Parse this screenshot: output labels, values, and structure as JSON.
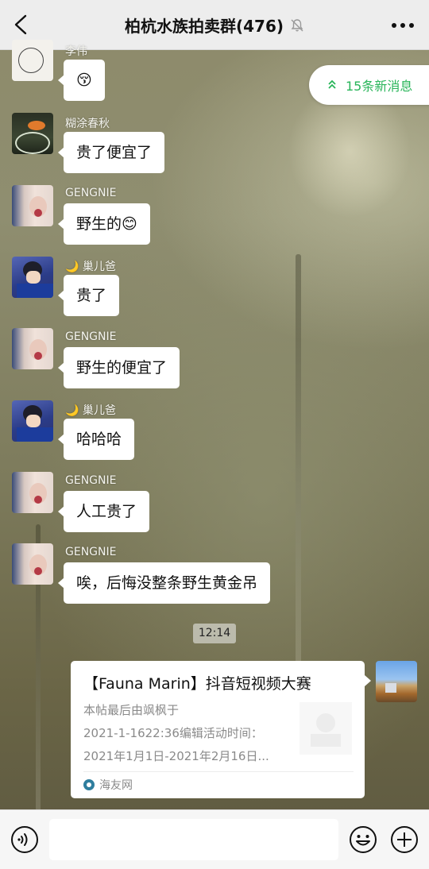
{
  "header": {
    "title": "柏杭水族拍卖群(476)"
  },
  "new_messages": {
    "label": "15条新消息"
  },
  "messages": [
    {
      "sender": "李伟",
      "text": "😚"
    },
    {
      "sender": "糊涂春秋",
      "text": "贵了便宜了"
    },
    {
      "sender": "GENGNIE",
      "text": "野生的😊"
    },
    {
      "sender": "🌙 巢儿爸",
      "text": "贵了"
    },
    {
      "sender": "GENGNIE",
      "text": "野生的便宜了"
    },
    {
      "sender": "🌙 巢儿爸",
      "text": "哈哈哈"
    },
    {
      "sender": "GENGNIE",
      "text": "人工贵了"
    },
    {
      "sender": "GENGNIE",
      "text": "唉，后悔没整条野生黄金吊"
    }
  ],
  "timestamp": "12:14",
  "card": {
    "title": "【Fauna Marin】抖音短视频大赛",
    "desc_lines": [
      "本帖最后由飒枫于",
      "2021-1-1622:36编辑活动时间：",
      "2021年1月1日-2021年2月16日..."
    ],
    "source": "海友网"
  },
  "input": {
    "value": ""
  }
}
